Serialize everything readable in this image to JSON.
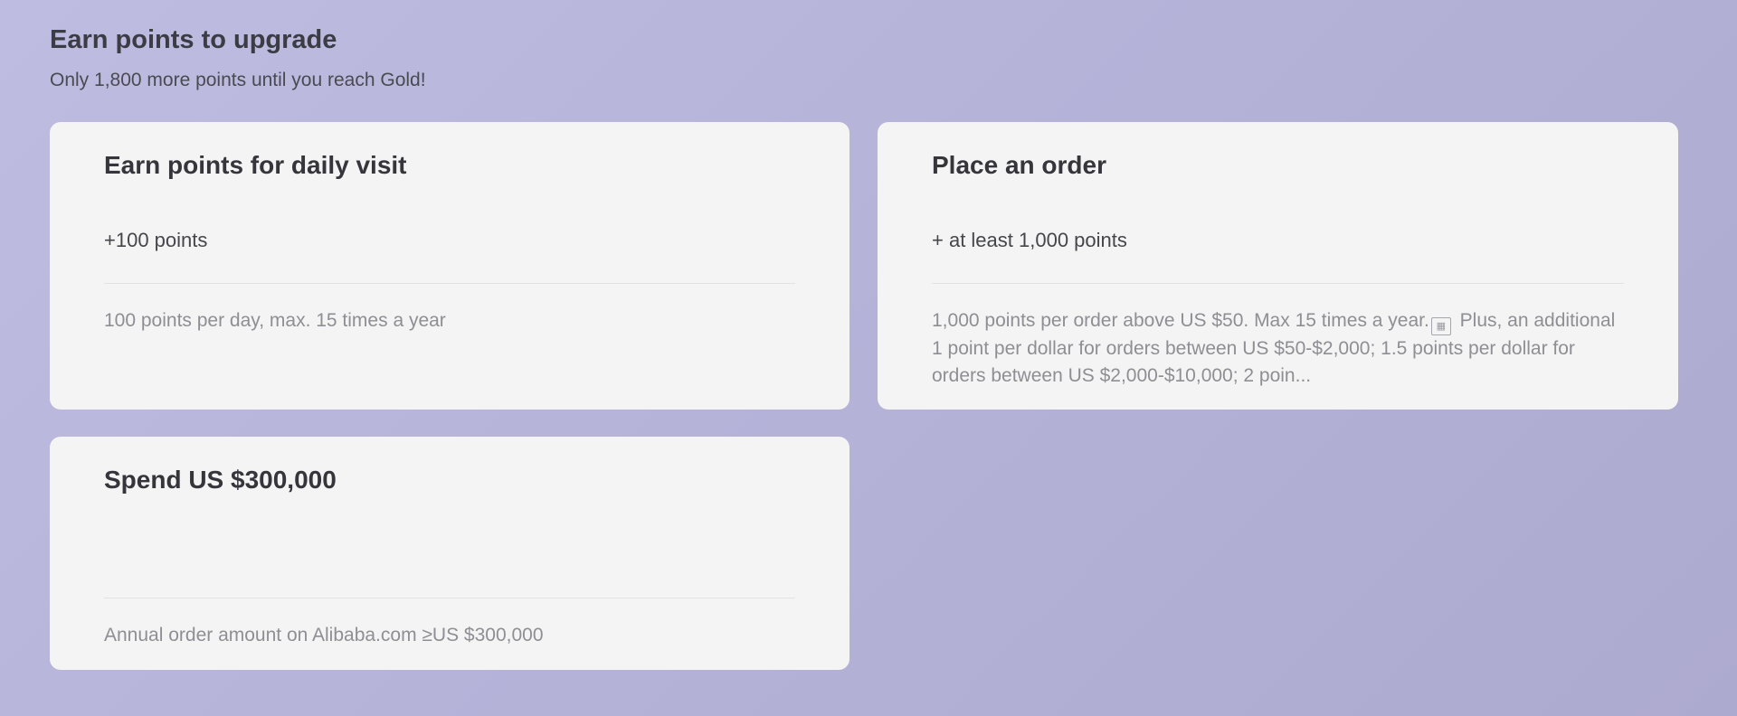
{
  "section": {
    "title": "Earn points to upgrade",
    "subtitle": "Only 1,800 more points until you reach Gold!"
  },
  "cards": [
    {
      "title": "Earn points for daily visit",
      "points": "+100 points",
      "description": "100 points per day, max. 15 times a year"
    },
    {
      "title": "Place an order",
      "points": "+ at least 1,000 points",
      "description_part1": "1,000 points per order above US $50. Max 15 times a year.",
      "description_part2": " Plus, an additional 1 point per dollar for orders between US $50-$2,000; 1.5 points per dollar for orders between US $2,000-$10,000; 2 poin...",
      "inline_icon": "image-placeholder-icon"
    },
    {
      "title": "Spend US $300,000",
      "points": "",
      "description": "Annual order amount on Alibaba.com ≥US $300,000"
    }
  ]
}
